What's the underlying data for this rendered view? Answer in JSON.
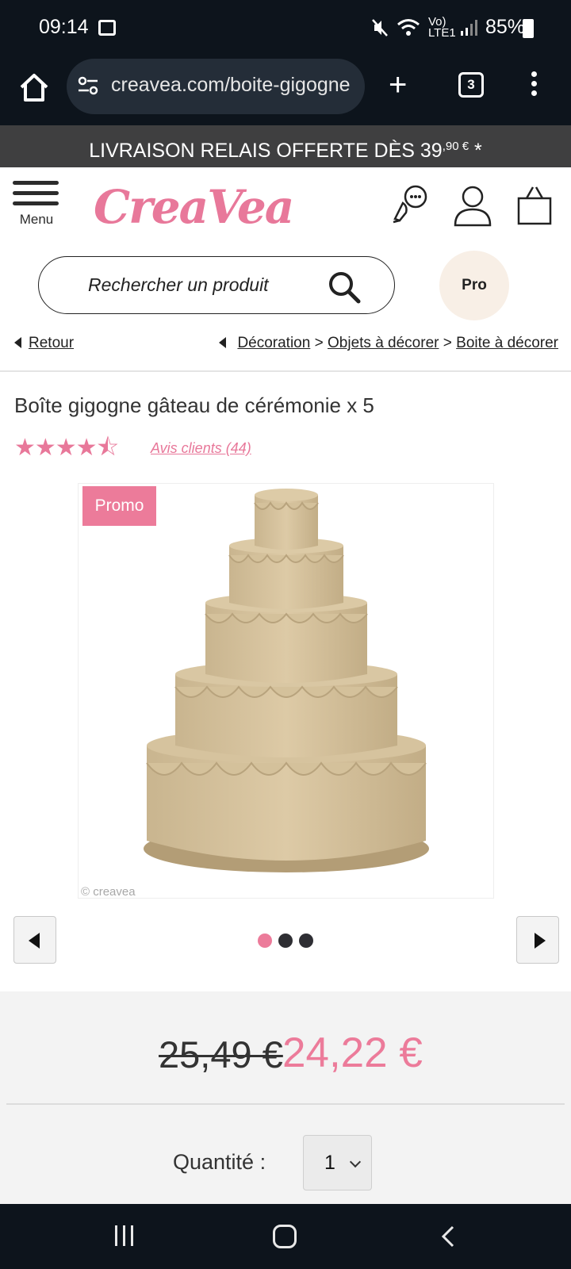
{
  "status_bar": {
    "time": "09:14",
    "signal_label": "Vo) LTE1",
    "battery": "85%"
  },
  "browser": {
    "url": "creavea.com/boite-gigogne",
    "tab_count": "3"
  },
  "banner": {
    "text": "LIVRAISON RELAIS OFFERTE DÈS 39",
    "cents": ",90 €",
    "star": "*"
  },
  "header": {
    "menu_label": "Menu",
    "logo_text": "CreaVea",
    "search_placeholder": "Rechercher un produit",
    "pro_label": "Pro"
  },
  "breadcrumb": {
    "back": "Retour",
    "items": [
      "Décoration",
      "Objets à décorer",
      "Boite à décorer"
    ],
    "separator": ">"
  },
  "product": {
    "title": "Boîte gigogne gâteau de cérémonie x 5",
    "rating": 4.5,
    "rating_stars": "★★★★⯪",
    "reviews_label": "Avis clients (44)",
    "promo_badge": "Promo",
    "watermark": "© creavea",
    "carousel": {
      "total": 3,
      "active": 1
    },
    "old_price": "25,49 €",
    "new_price": "24,22 €",
    "quantity_label": "Quantité :",
    "quantity_value": "1"
  },
  "colors": {
    "brand_pink": "#ec7b9a",
    "dark": "#0d141c",
    "banner": "#3f3f40"
  }
}
